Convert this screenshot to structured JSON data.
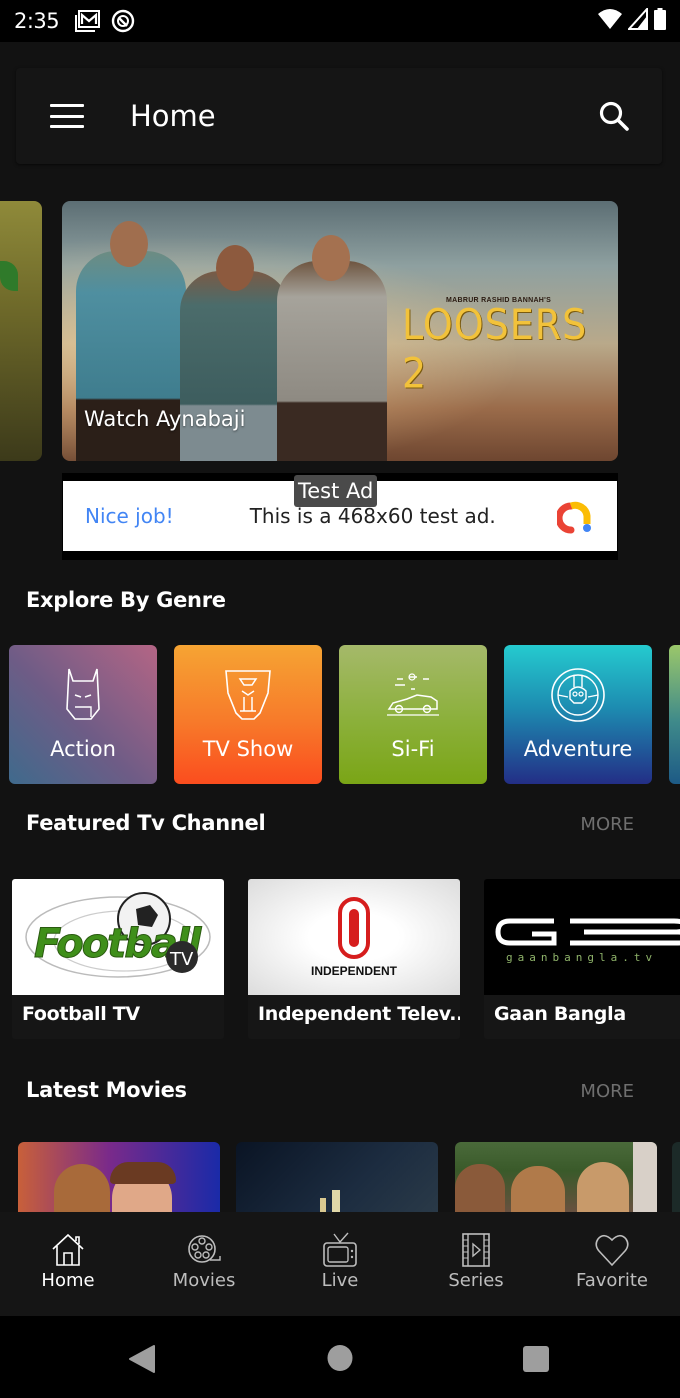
{
  "status_bar": {
    "time": "2:35",
    "left_icons": [
      "gmail-icon",
      "vpn-badge-icon"
    ],
    "right_icons": [
      "wifi-icon",
      "cellular-signal-icon",
      "battery-icon"
    ]
  },
  "app_bar": {
    "title": "Home",
    "menu_icon": "hamburger-menu-icon",
    "search_icon": "search-icon"
  },
  "banner": {
    "caption": "Watch Aynabaji",
    "poster_title": "LOOSERS 2",
    "poster_credit": "MABRUR RASHID BANNAH'S"
  },
  "ad": {
    "label": "Test Ad",
    "headline": "Nice job!",
    "message": "This is a 468x60 test ad.",
    "headline_color": "#4285f4"
  },
  "genres": {
    "title": "Explore By Genre",
    "items": [
      {
        "label": "Action",
        "icon": "batman-mask-icon"
      },
      {
        "label": "TV Show",
        "icon": "transformer-head-icon"
      },
      {
        "label": "Si-Fi",
        "icon": "flying-car-icon"
      },
      {
        "label": "Adventure",
        "icon": "skull-wheel-icon"
      }
    ]
  },
  "featured_channels": {
    "title": "Featured Tv Channel",
    "more_label": "MORE",
    "items": [
      {
        "name": "Football TV",
        "logo_text": "Football",
        "logo_badge": "TV"
      },
      {
        "name": "Independent Telev...",
        "logo_text": "INDEPENDENT"
      },
      {
        "name": "Gaan Bangla",
        "logo_text": "GB",
        "logo_sub": "gaanbangla.tv"
      }
    ]
  },
  "latest_movies": {
    "title": "Latest Movies",
    "more_label": "MORE",
    "items": [
      {
        "poster": "animated-spies-poster"
      },
      {
        "poster": "dark-night-poster"
      },
      {
        "poster": "period-drama-poster"
      }
    ]
  },
  "bottom_nav": {
    "items": [
      {
        "label": "Home",
        "icon": "home-icon",
        "active": true
      },
      {
        "label": "Movies",
        "icon": "film-reel-icon",
        "active": false
      },
      {
        "label": "Live",
        "icon": "tv-icon",
        "active": false
      },
      {
        "label": "Series",
        "icon": "film-strip-play-icon",
        "active": false
      },
      {
        "label": "Favorite",
        "icon": "heart-icon",
        "active": false
      }
    ]
  },
  "system_nav": {
    "buttons": [
      "back",
      "home",
      "recents"
    ]
  }
}
